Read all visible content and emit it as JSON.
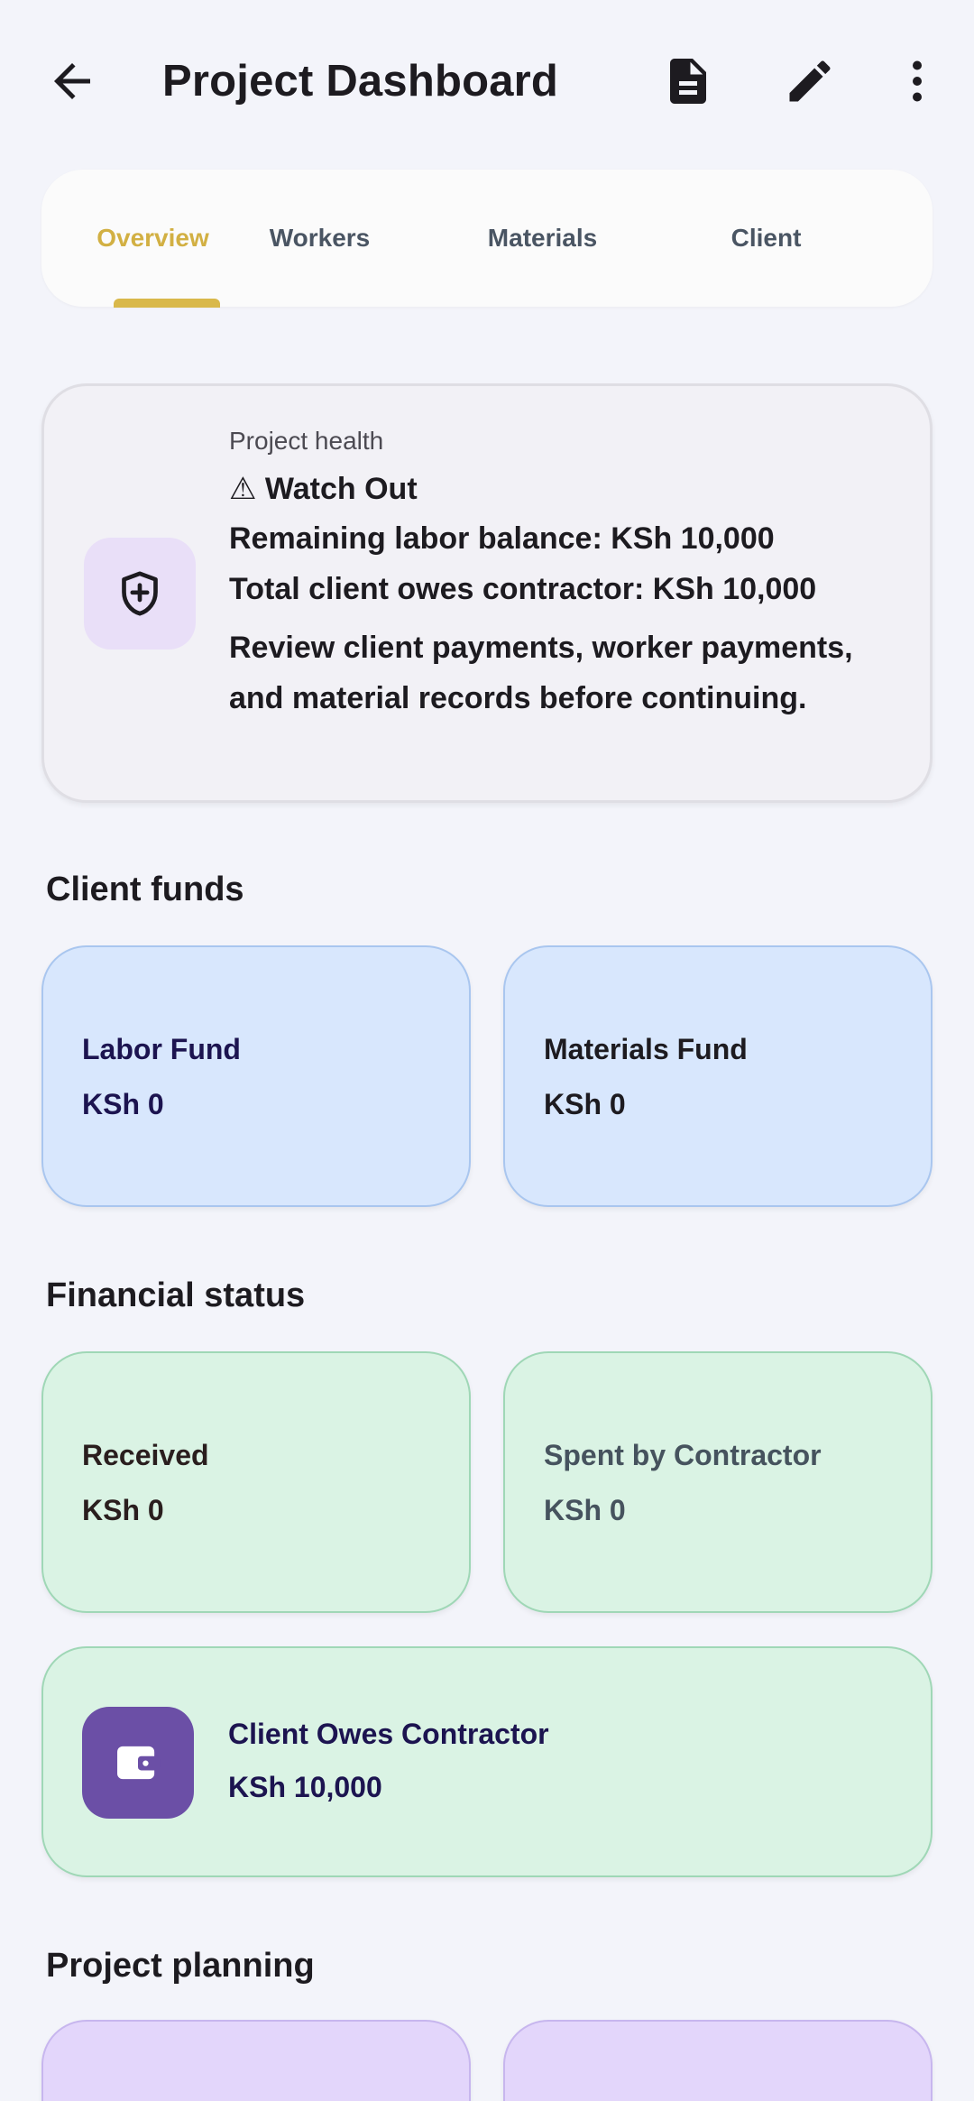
{
  "appbar": {
    "title": "Project Dashboard",
    "icons": [
      "arrow-back-icon",
      "document-icon",
      "pencil-icon",
      "more-vert-icon"
    ]
  },
  "tabs": {
    "items": [
      {
        "label": "Overview",
        "active": true
      },
      {
        "label": "Workers",
        "active": false
      },
      {
        "label": "Materials",
        "active": false
      },
      {
        "label": "Client",
        "active": false
      }
    ]
  },
  "health": {
    "label": "Project health",
    "status": "⚠ Watch Out",
    "line1": "Remaining labor balance: KSh 10,000",
    "line2": "Total client owes contractor: KSh 10,000",
    "line3": "Review client payments, worker payments, and material records before continuing."
  },
  "client_funds": {
    "title": "Client funds",
    "labor": {
      "label": "Labor Fund",
      "value": "KSh 0"
    },
    "materials": {
      "label": "Materials Fund",
      "value": "KSh 0"
    }
  },
  "financial_status": {
    "title": "Financial status",
    "received": {
      "label": "Received",
      "value": "KSh 0"
    },
    "spent": {
      "label": "Spent by Contractor",
      "value": "KSh 0"
    },
    "owes": {
      "label": "Client Owes Contractor",
      "value": "KSh 10,000"
    }
  },
  "project_planning": {
    "title": "Project planning"
  },
  "colors": {
    "accent": "#d9b84a",
    "fund_card": "#d8e7fd",
    "status_card": "#daf3e4",
    "planning_card": "#e3d6fb",
    "wallet": "#6b4fa6"
  }
}
